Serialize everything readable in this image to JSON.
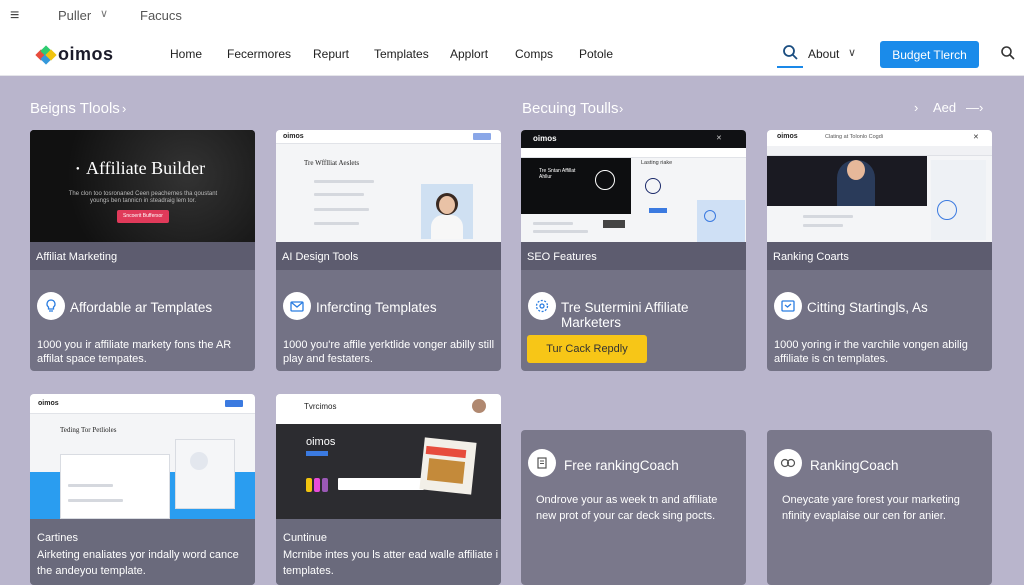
{
  "topbar": {
    "item1": "Puller",
    "item2": "Facucs"
  },
  "nav": {
    "logo": "oimos",
    "links": [
      "Home",
      "Fecermores",
      "Repurt",
      "Templates",
      "Applort",
      "Comps",
      "Potole"
    ],
    "about": "About",
    "cta": "Budget Tlerch"
  },
  "sections": {
    "left": "Beigns Tlools",
    "right": "Becuing Toulls",
    "right_extra": "Aed"
  },
  "cards": [
    {
      "hero_title": "Affiliate Builder",
      "hero_sub": "The clon too tosronaned Ceen peachernes tha qoustant youngs ben tannicn in steadraig lem tor.",
      "hero_btn": "Sncoerit Buffersor",
      "caption": "Affiliat Marketing",
      "title": "Affordable ar Templates",
      "desc": "1000 you ir affiliate markety fons the AR affilat space tempates."
    },
    {
      "thumb_logo": "oimos",
      "thumb_head": "Tre Wfflliat Aeslets",
      "caption": "AI Design Tools",
      "title": "Infercting Templates",
      "desc": "1000 you're affile yerktlide vonger abilly still play and festaters."
    },
    {
      "thumb_logo": "oimos",
      "thumb_text": "Tre Sntan Affillat Ahllur",
      "thumb_label": "Lasting riake",
      "caption": "SEO Features",
      "title": "Tre Sutermini Affiliate Marketers",
      "button": "Tur Cack Repdly"
    },
    {
      "thumb_logo": "oimos",
      "thumb_text": "Clating at Tolonlo Cogdi",
      "caption": "Ranking Coarts",
      "title": "Citting Startingls, As",
      "desc": "1000 yoring ir the varchile vongen abilig affiliate is cn templates."
    }
  ],
  "row2": [
    {
      "thumb_logo": "oimos",
      "thumb_head": "Teding Tor Petlioles",
      "title": "Cartines",
      "desc": "Airketing enaliates yor indally word cance the andeyou template."
    },
    {
      "thumb_logo": "Tvrcimos",
      "thumb_brand": "oimos",
      "title": "Cuntinue",
      "desc": "Mcrnibe intes you ls atter ead walle affiliate i templates."
    },
    {
      "title": "Free rankingCoach",
      "desc": "Ondrove your as week tn and affiliate new prot of your car deck sing pocts."
    },
    {
      "title": "RankingCoach",
      "desc": "Oneycate yare forest your marketing nfinity evaplaise our cen for anier."
    }
  ],
  "colors": {
    "accent": "#1a8bea",
    "yellow": "#f7c617",
    "bg": "#b9b5cc",
    "card": "#737285"
  }
}
